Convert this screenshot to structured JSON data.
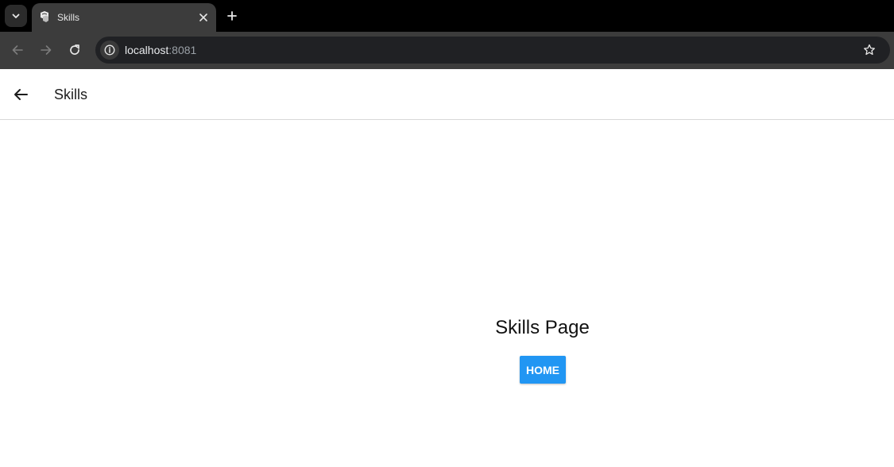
{
  "browser": {
    "tab": {
      "title": "Skills"
    },
    "address": {
      "host": "localhost",
      "port": ":8081"
    }
  },
  "app": {
    "header": {
      "title": "Skills"
    },
    "main": {
      "heading": "Skills Page",
      "home_button_label": "HOME"
    }
  },
  "colors": {
    "primary_button": "#2196f3",
    "tabstrip": "#000000",
    "toolbar": "#3c3c3c"
  }
}
